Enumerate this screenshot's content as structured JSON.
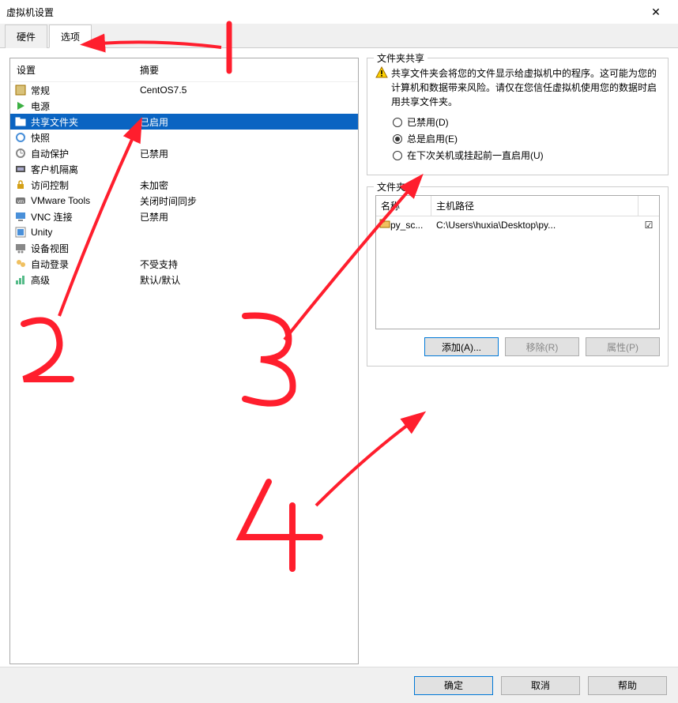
{
  "window": {
    "title": "虚拟机设置"
  },
  "tabs": {
    "hardware": "硬件",
    "options": "选项"
  },
  "columns": {
    "setting": "设置",
    "summary": "摘要"
  },
  "settings": [
    {
      "icon": "general",
      "name": "常规",
      "summary": "CentOS7.5"
    },
    {
      "icon": "power",
      "name": "电源",
      "summary": ""
    },
    {
      "icon": "shared-folder",
      "name": "共享文件夹",
      "summary": "已启用",
      "selected": true
    },
    {
      "icon": "snapshot",
      "name": "快照",
      "summary": ""
    },
    {
      "icon": "autoprotect",
      "name": "自动保护",
      "summary": "已禁用"
    },
    {
      "icon": "guest-isolation",
      "name": "客户机隔离",
      "summary": ""
    },
    {
      "icon": "access-control",
      "name": "访问控制",
      "summary": "未加密"
    },
    {
      "icon": "vmware-tools",
      "name": "VMware Tools",
      "summary": "关闭时间同步"
    },
    {
      "icon": "vnc",
      "name": "VNC 连接",
      "summary": "已禁用"
    },
    {
      "icon": "unity",
      "name": "Unity",
      "summary": ""
    },
    {
      "icon": "device-view",
      "name": "设备视图",
      "summary": ""
    },
    {
      "icon": "autologin",
      "name": "自动登录",
      "summary": "不受支持"
    },
    {
      "icon": "advanced",
      "name": "高级",
      "summary": "默认/默认"
    }
  ],
  "share": {
    "group_title": "文件夹共享",
    "warning_text": "共享文件夹会将您的文件显示给虚拟机中的程序。这可能为您的计算机和数据带来风险。请仅在您信任虚拟机使用您的数据时启用共享文件夹。",
    "radios": {
      "disabled": "已禁用(D)",
      "always": "总是启用(E)",
      "until_shutdown": "在下次关机或挂起前一直启用(U)"
    }
  },
  "folders": {
    "group_title": "文件夹(F)",
    "headers": {
      "name": "名称",
      "host_path": "主机路径"
    },
    "rows": [
      {
        "name": "py_sc...",
        "path": "C:\\Users\\huxia\\Desktop\\py...",
        "enabled": true
      }
    ]
  },
  "buttons": {
    "add": "添加(A)...",
    "remove": "移除(R)",
    "properties": "属性(P)",
    "ok": "确定",
    "cancel": "取消",
    "help": "帮助"
  },
  "annotations": {
    "n1": "1",
    "n2": "2",
    "n3": "3",
    "n4": "4"
  }
}
